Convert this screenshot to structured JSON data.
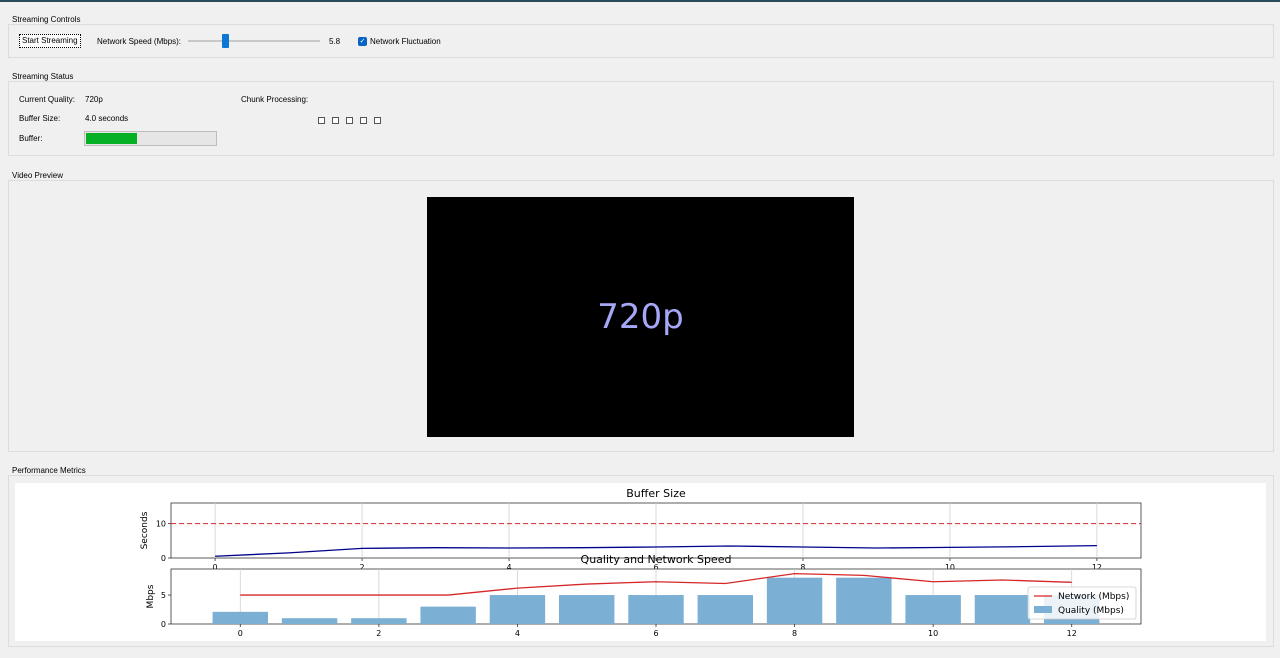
{
  "controls": {
    "group_title": "Streaming Controls",
    "start_button": "Start Streaming",
    "speed_label": "Network Speed (Mbps):",
    "speed_value": "5.8",
    "slider_fraction": 0.28,
    "fluctuation_label": "Network Fluctuation",
    "fluctuation_checked": true
  },
  "status": {
    "group_title": "Streaming Status",
    "quality_label": "Current Quality:",
    "quality_value": "720p",
    "buffer_size_label": "Buffer Size:",
    "buffer_size_value": "4.0 seconds",
    "buffer_label": "Buffer:",
    "buffer_fraction": 0.39,
    "chunk_label": "Chunk Processing:",
    "chunk_glyphs": [
      "□",
      "□",
      "□",
      "□",
      "□"
    ]
  },
  "video": {
    "group_title": "Video Preview",
    "display_text": "720p",
    "text_color": "#a7a7f7"
  },
  "metrics": {
    "group_title": "Performance Metrics"
  },
  "chart_data": [
    {
      "type": "line",
      "title": "Buffer Size",
      "ylabel": "Seconds",
      "xlabel": "",
      "x": [
        0,
        1,
        2,
        3,
        4,
        5,
        6,
        7,
        8,
        9,
        10,
        11,
        12
      ],
      "series": [
        {
          "values": [
            0.5,
            1.5,
            2.8,
            3.0,
            2.9,
            3.0,
            3.2,
            3.5,
            3.2,
            2.9,
            3.1,
            3.3,
            3.6
          ],
          "color": "#00008b"
        }
      ],
      "reference_line": {
        "y": 10,
        "color": "#d62728",
        "style": "dashed"
      },
      "xticks": [
        "0",
        "2",
        "4",
        "6",
        "8",
        "10",
        "12"
      ],
      "yticks": [
        "0",
        "10"
      ],
      "xlim": [
        -0.6,
        12.6
      ],
      "ylim": [
        0,
        16
      ],
      "grid": true
    },
    {
      "type": "bar",
      "title": "Quality and Network Speed",
      "ylabel": "Mbps",
      "xlabel": "",
      "x": [
        0,
        1,
        2,
        3,
        4,
        5,
        6,
        7,
        8,
        9,
        10,
        11,
        12
      ],
      "series": [
        {
          "name": "Network (Mbps)",
          "type": "line",
          "color": "#d62728",
          "values": [
            5.0,
            5.0,
            5.0,
            5.0,
            6.2,
            6.9,
            7.3,
            7.0,
            8.7,
            8.4,
            7.3,
            7.6,
            7.2
          ]
        },
        {
          "name": "Quality (Mbps)",
          "type": "bar",
          "color": "#7bafd4",
          "values": [
            2.1,
            1.0,
            1.0,
            3.0,
            5.0,
            5.0,
            5.0,
            5.0,
            8.0,
            8.0,
            5.0,
            5.0,
            5.0
          ]
        }
      ],
      "xticks": [
        "0",
        "2",
        "4",
        "6",
        "8",
        "10",
        "12"
      ],
      "yticks": [
        "0",
        "5"
      ],
      "xlim": [
        -1.0,
        13.0
      ],
      "ylim": [
        0,
        9.5
      ],
      "legend": "bottom-right",
      "grid": true
    }
  ]
}
